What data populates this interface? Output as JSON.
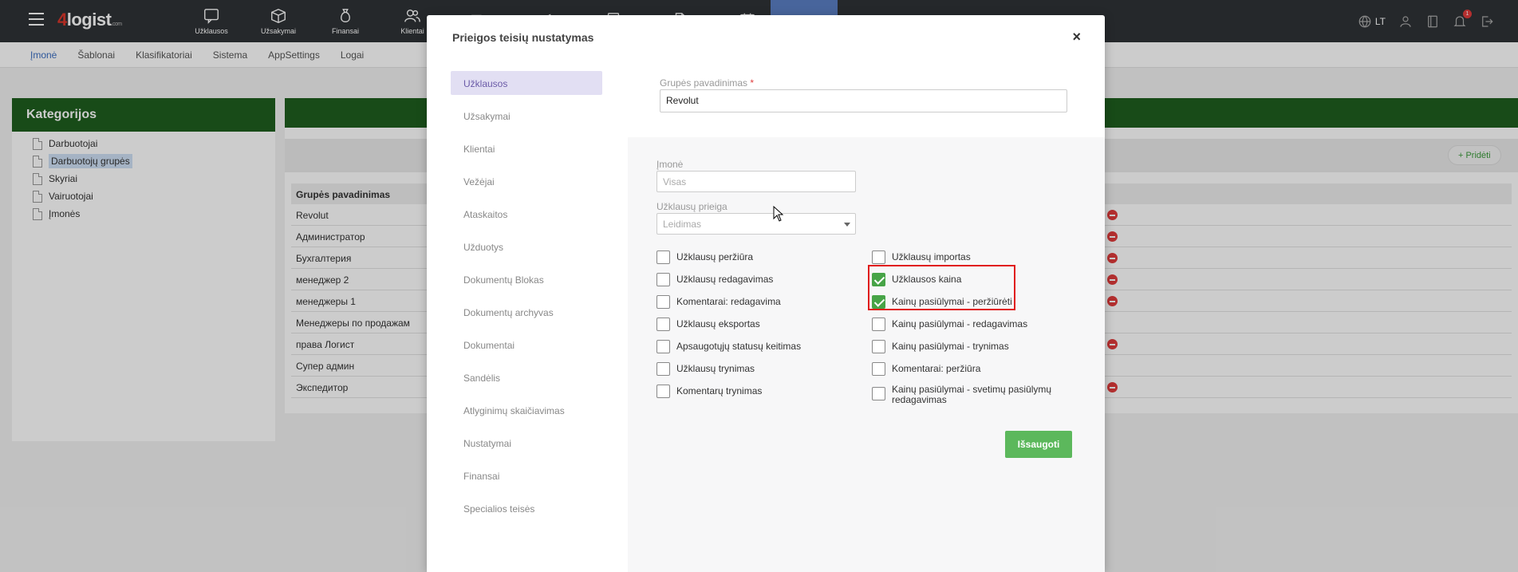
{
  "app": {
    "brand": {
      "four": "4",
      "rest": "logist",
      "suffix": ".com"
    },
    "nav": [
      {
        "label": "Užklausos",
        "icon": "chat-question-icon"
      },
      {
        "label": "Užsakymai",
        "icon": "package-icon"
      },
      {
        "label": "Finansai",
        "icon": "money-bag-icon"
      },
      {
        "label": "Klientai",
        "icon": "users-icon"
      },
      {
        "label": "",
        "icon": "truck-icon"
      },
      {
        "label": "",
        "icon": "megaphone-icon"
      },
      {
        "label": "",
        "icon": "calculator-icon"
      },
      {
        "label": "",
        "icon": "document-icon"
      },
      {
        "label": "",
        "icon": "calendar-icon"
      }
    ],
    "lang": "LT",
    "notification_count": "1"
  },
  "subnav": [
    "Įmonė",
    "Šablonai",
    "Klasifikatoriai",
    "Sistema",
    "AppSettings",
    "Logai"
  ],
  "categories": {
    "title": "Kategorijos",
    "items": [
      "Darbuotojai",
      "Darbuotojų grupės",
      "Skyriai",
      "Vairuotojai",
      "Įmonės"
    ]
  },
  "groups": {
    "add_label": "Pridėti",
    "header": "Grupės pavadinimas",
    "rows": [
      "Revolut",
      "Администратор",
      "Бухгалтерия",
      "менеджер 2",
      "менеджеры 1",
      "Менеджеры по продажам",
      "права Логист",
      "Супер админ",
      "Экспедитор"
    ]
  },
  "modal": {
    "title": "Prieigos teisių nustatymas",
    "close": "×",
    "side_items": [
      "Užklausos",
      "Užsakymai",
      "Klientai",
      "Vežėjai",
      "Ataskaitos",
      "Užduotys",
      "Dokumentų Blokas",
      "Dokumentų archyvas",
      "Dokumentai",
      "Sandėlis",
      "Atlyginimų skaičiavimas",
      "Nustatymai",
      "Finansai",
      "Specialios teisės"
    ],
    "group_name_label": "Grupės pavadinimas",
    "required_mark": "*",
    "group_name_value": "Revolut",
    "company_label": "Įmonė",
    "company_placeholder": "Visas",
    "access_label": "Užklausų prieiga",
    "access_placeholder": "Leidimas",
    "left_checks": [
      {
        "label": "Užklausų peržiūra",
        "checked": false
      },
      {
        "label": "Užklausų redagavimas",
        "checked": false
      },
      {
        "label": "Komentarai: redagavima",
        "checked": false
      },
      {
        "label": "Užklausų eksportas",
        "checked": false
      },
      {
        "label": "Apsaugotųjų statusų keitimas",
        "checked": false
      },
      {
        "label": "Užklausų trynimas",
        "checked": false
      },
      {
        "label": "Komentarų trynimas",
        "checked": false
      }
    ],
    "right_checks": [
      {
        "label": "Užklausų importas",
        "checked": false
      },
      {
        "label": "Užklausos kaina",
        "checked": true
      },
      {
        "label": "Kainų pasiūlymai - peržiūrėti",
        "checked": true
      },
      {
        "label": "Kainų pasiūlymai - redagavimas",
        "checked": false
      },
      {
        "label": "Kainų pasiūlymai - trynimas",
        "checked": false
      },
      {
        "label": "Komentarai: peržiūra",
        "checked": false
      },
      {
        "label": "Kainų pasiūlymai - svetimų pasiūlymų",
        "label2": "redagavimas",
        "checked": false
      }
    ],
    "save_label": "Išsaugoti"
  },
  "colors": {
    "topbar": "#2f3236",
    "panel_header": "#1e5e1e",
    "active_side": "#e2dff3",
    "check_green": "#47a447",
    "highlight_red": "#e01b1b",
    "save_green": "#5cb85c"
  }
}
